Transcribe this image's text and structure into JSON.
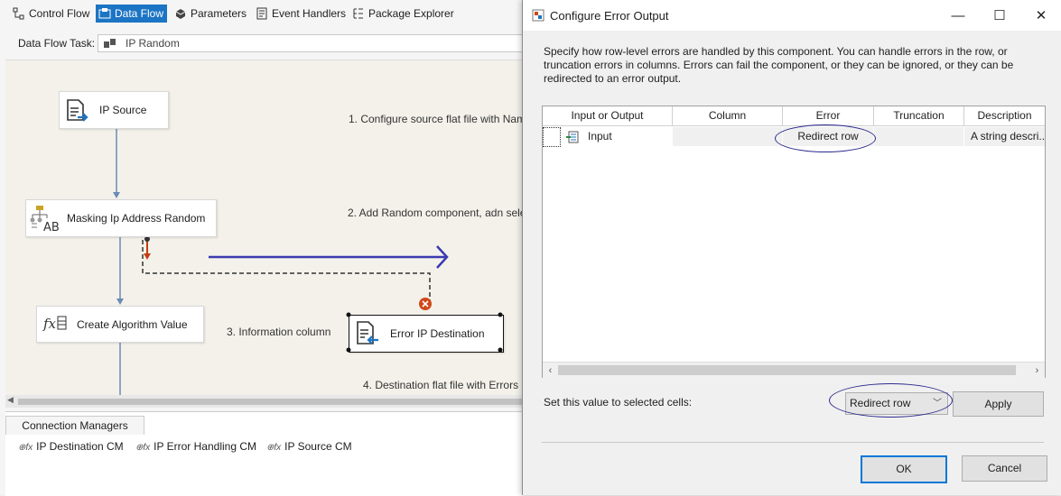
{
  "designer": {
    "tabs": [
      {
        "label": "Control Flow",
        "icon": "control-flow-icon"
      },
      {
        "label": "Data Flow",
        "icon": "data-flow-icon",
        "active": true
      },
      {
        "label": "Parameters",
        "icon": "parameters-icon"
      },
      {
        "label": "Event Handlers",
        "icon": "event-handlers-icon"
      },
      {
        "label": "Package Explorer",
        "icon": "package-explorer-icon"
      }
    ],
    "task_label": "Data Flow Task:",
    "task_value": "IP Random",
    "nodes": {
      "ip_source": "IP Source",
      "masking": "Masking Ip Address Random",
      "create_algorithm": "Create Algorithm Value",
      "error_destination": "Error IP Destination"
    },
    "notes": {
      "n1": "1. Configure source flat file with Nam",
      "n2": "2. Add Random component, adn sele",
      "n3": "3. Information column",
      "n4": "4. Destination flat file with Errors"
    },
    "connection_managers": {
      "tab_label": "Connection Managers",
      "items": [
        "IP Destination CM",
        "IP Error Handling CM",
        "IP Source CM"
      ]
    },
    "colors": {
      "tab_active": "#1c74c4",
      "arrow_accent": "#3a3ab0",
      "error_path": "#c43d12"
    }
  },
  "dialog": {
    "title": "Configure Error Output",
    "window_controls": {
      "minimize": "—",
      "maximize": "☐",
      "close": "✕"
    },
    "description": "Specify how row-level errors are handled by this component. You can handle errors in the row, or truncation errors in columns. Errors can fail the component, or they can be ignored, or they can be redirected to an error output.",
    "grid": {
      "headers": [
        "Input or Output",
        "Column",
        "Error",
        "Truncation",
        "Description"
      ],
      "rows": [
        {
          "input_or_output": "Input",
          "column": "",
          "error": "Redirect row",
          "truncation": "",
          "description": "A string descri..."
        }
      ]
    },
    "set_value_label": "Set this value to selected cells:",
    "set_value_selected": "Redirect row",
    "apply_label": "Apply",
    "ok_label": "OK",
    "cancel_label": "Cancel",
    "colors": {
      "ok_border": "#0078d7",
      "highlight_ellipse": "#2b2b8f"
    }
  }
}
